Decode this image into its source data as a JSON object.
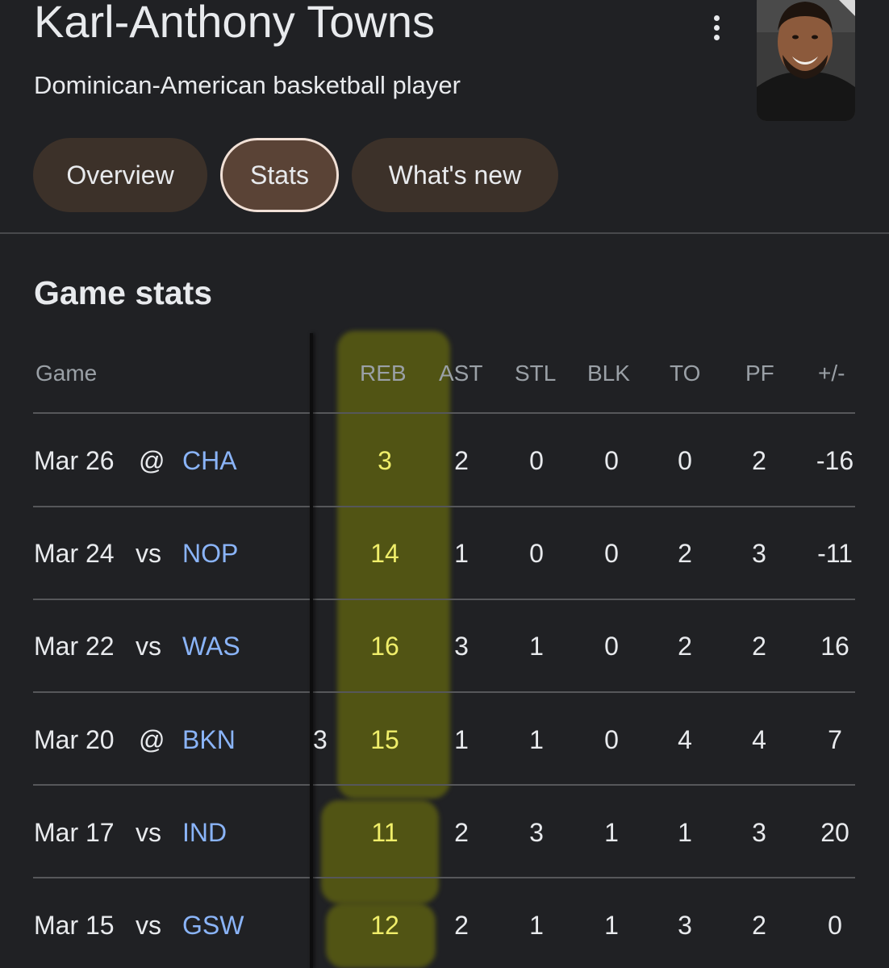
{
  "player": {
    "name": "Karl-Anthony Towns",
    "description": "Dominican-American basketball player"
  },
  "tabs": [
    {
      "label": "Overview",
      "selected": false
    },
    {
      "label": "Stats",
      "selected": true
    },
    {
      "label": "What's new",
      "selected": false
    }
  ],
  "section_title": "Game stats",
  "columns": {
    "game": "Game",
    "reb": "REB",
    "ast": "AST",
    "stl": "STL",
    "blk": "BLK",
    "to": "TO",
    "pf": "PF",
    "pm": "+/-"
  },
  "games": [
    {
      "date": "Mar 26",
      "venue": "@",
      "team": "CHA",
      "reb": "3",
      "ast": "2",
      "stl": "0",
      "blk": "0",
      "to": "0",
      "pf": "2",
      "pm": "-16"
    },
    {
      "date": "Mar 24",
      "venue": "vs",
      "team": "NOP",
      "reb": "14",
      "ast": "1",
      "stl": "0",
      "blk": "0",
      "to": "2",
      "pf": "3",
      "pm": "-11"
    },
    {
      "date": "Mar 22",
      "venue": "vs",
      "team": "WAS",
      "reb": "16",
      "ast": "3",
      "stl": "1",
      "blk": "0",
      "to": "2",
      "pf": "2",
      "pm": "16"
    },
    {
      "date": "Mar 20",
      "venue": "@",
      "team": "BKN",
      "reb": "15",
      "ast": "1",
      "stl": "1",
      "blk": "0",
      "to": "4",
      "pf": "4",
      "pm": "7"
    },
    {
      "date": "Mar 17",
      "venue": "vs",
      "team": "IND",
      "reb": "11",
      "ast": "2",
      "stl": "3",
      "blk": "1",
      "to": "1",
      "pf": "3",
      "pm": "20"
    },
    {
      "date": "Mar 15",
      "venue": "vs",
      "team": "GSW",
      "reb": "12",
      "ast": "2",
      "stl": "1",
      "blk": "1",
      "to": "3",
      "pf": "2",
      "pm": "0"
    }
  ],
  "clipped_prev_column_value": "3",
  "colors": {
    "background": "#202124",
    "chip": "#3c3129",
    "chip_selected": "#5a4336",
    "team_link": "#8ab4f8",
    "highlight_marker": "#9a9b00"
  },
  "icons": {
    "more": "vertical-dots-icon"
  }
}
